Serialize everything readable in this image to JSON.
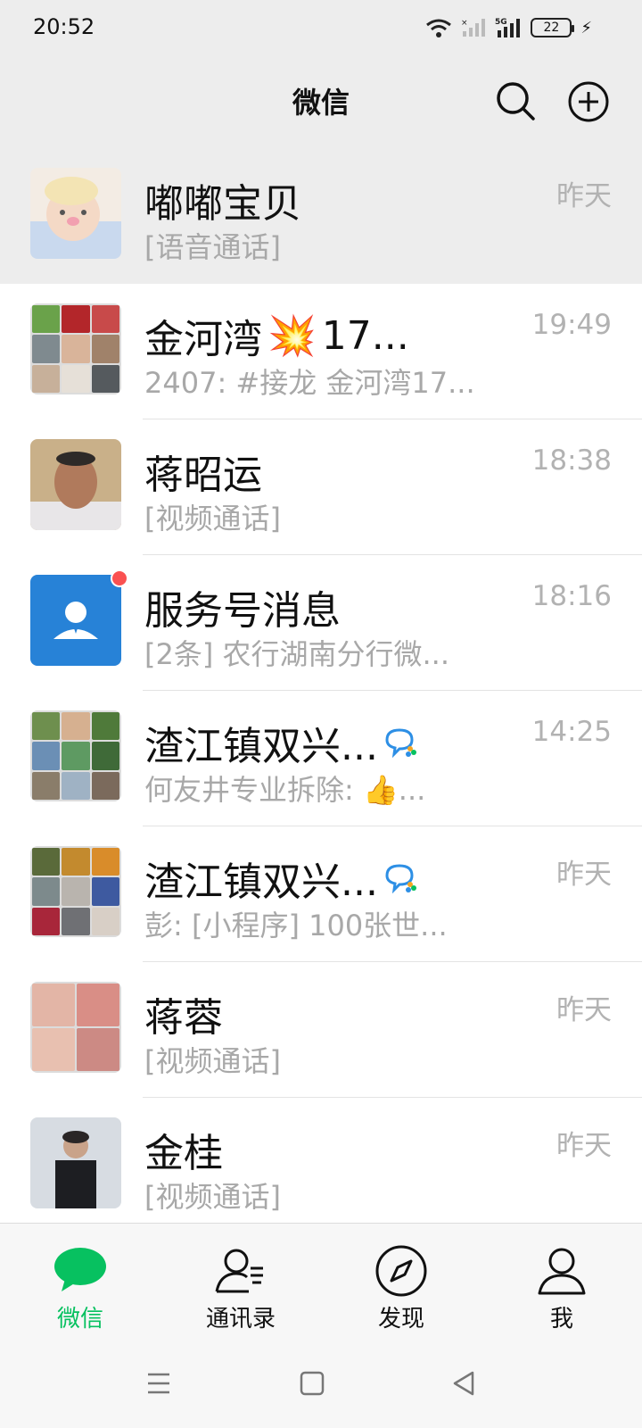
{
  "status_bar": {
    "time": "20:52",
    "battery": "22"
  },
  "header": {
    "title": "微信",
    "icons": [
      "search-icon",
      "add-icon"
    ]
  },
  "chats": [
    {
      "name": "嘟嘟宝贝",
      "preview": "[语音通话]",
      "time": "昨天",
      "pinned": true
    },
    {
      "name": "金河湾",
      "name_emoji": "💥",
      "name_suffix": "17...",
      "preview": "2407: #接龙 金河湾17...",
      "time": "19:49"
    },
    {
      "name": "蒋昭运",
      "preview": "[视频通话]",
      "time": "18:38"
    },
    {
      "name": "服务号消息",
      "preview": "[2条] 农行湖南分行微...",
      "time": "18:16",
      "unread_dot": true
    },
    {
      "name": "渣江镇双兴...",
      "preview": "何友井专业拆除: 👍...",
      "time": "14:25",
      "group_icon": "enterprise-chat-icon"
    },
    {
      "name": "渣江镇双兴...",
      "preview": "彭: [小程序] 100张世...",
      "time": "昨天",
      "group_icon": "enterprise-chat-icon"
    },
    {
      "name": "蒋蓉",
      "preview": "[视频通话]",
      "time": "昨天"
    },
    {
      "name": "金桂",
      "preview": "[视频通话]",
      "time": "昨天"
    }
  ],
  "tabs": [
    {
      "label": "微信",
      "icon": "chat-bubble-icon",
      "active": true
    },
    {
      "label": "通讯录",
      "icon": "contacts-icon",
      "active": false
    },
    {
      "label": "发现",
      "icon": "compass-icon",
      "active": false
    },
    {
      "label": "我",
      "icon": "person-icon",
      "active": false
    }
  ],
  "colors": {
    "accent": "#07c160",
    "badge": "#fa5151",
    "service_avatar": "#2782d7"
  }
}
